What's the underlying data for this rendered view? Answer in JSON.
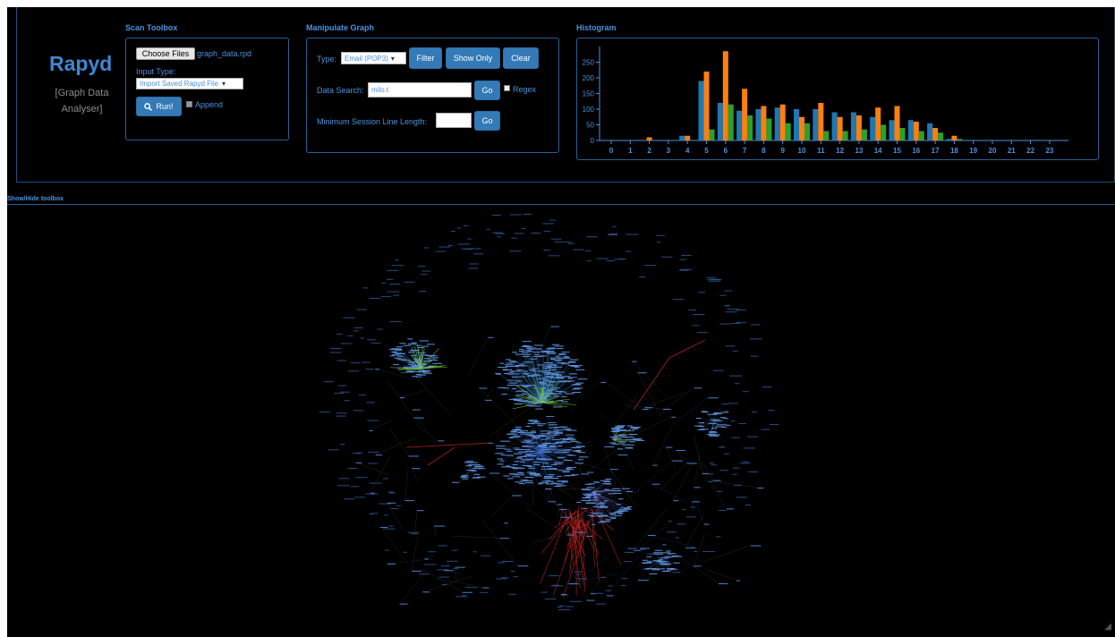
{
  "app": {
    "name": "Rapyd",
    "subtitle": "[Graph Data Analyser]"
  },
  "scan_toolbox": {
    "title": "Scan Toolbox",
    "choose_files_label": "Choose Files",
    "file_name": "graph_data.rpd",
    "input_type_label": "Input Type:",
    "input_type_value": "Import Saved Rapyd File",
    "run_label": "Run!",
    "append_label": "Append",
    "append_checked": true
  },
  "manipulate_graph": {
    "title": "Manipulate Graph",
    "type_label": "Type:",
    "type_value": "Email (POP3)",
    "filter_label": "Filter",
    "show_only_label": "Show Only",
    "clear_label": "Clear",
    "data_search_label": "Data Search:",
    "data_search_value": "milo.t",
    "go_label": "Go",
    "regex_label": "Regex",
    "regex_checked": false,
    "min_session_label": "Minimum Session Line Length:",
    "min_session_value": "",
    "go2_label": "Go"
  },
  "histogram": {
    "title": "Histogram"
  },
  "show_hide_label": "Show/Hide toolbox",
  "colors": {
    "accent": "#4b91e0",
    "button": "#337ab7",
    "series_blue": "#1f77b4",
    "series_orange": "#ff7f0e",
    "series_green": "#2ca02c",
    "edge_red": "#d62728",
    "edge_green": "#7fd32c",
    "edge_purple": "#8f8fff"
  },
  "chart_data": {
    "type": "bar",
    "categories": [
      "0",
      "1",
      "2",
      "3",
      "4",
      "5",
      "6",
      "7",
      "8",
      "9",
      "10",
      "11",
      "12",
      "13",
      "14",
      "15",
      "16",
      "17",
      "18",
      "19",
      "20",
      "21",
      "22",
      "23"
    ],
    "series": [
      {
        "values": [
          0,
          0,
          0,
          0,
          15,
          190,
          120,
          95,
          100,
          105,
          100,
          100,
          90,
          90,
          75,
          65,
          65,
          55,
          5,
          0,
          0,
          0,
          0,
          0
        ]
      },
      {
        "values": [
          0,
          0,
          10,
          0,
          15,
          220,
          285,
          165,
          110,
          115,
          75,
          120,
          75,
          80,
          105,
          110,
          60,
          40,
          15,
          0,
          0,
          0,
          0,
          0
        ]
      },
      {
        "values": [
          0,
          0,
          0,
          0,
          0,
          35,
          115,
          80,
          70,
          55,
          55,
          30,
          30,
          35,
          50,
          40,
          30,
          25,
          5,
          0,
          0,
          0,
          0,
          0
        ]
      }
    ],
    "ylim": [
      0,
      300
    ],
    "yticks": [
      0,
      50,
      100,
      150,
      200,
      250
    ],
    "grid": false
  }
}
